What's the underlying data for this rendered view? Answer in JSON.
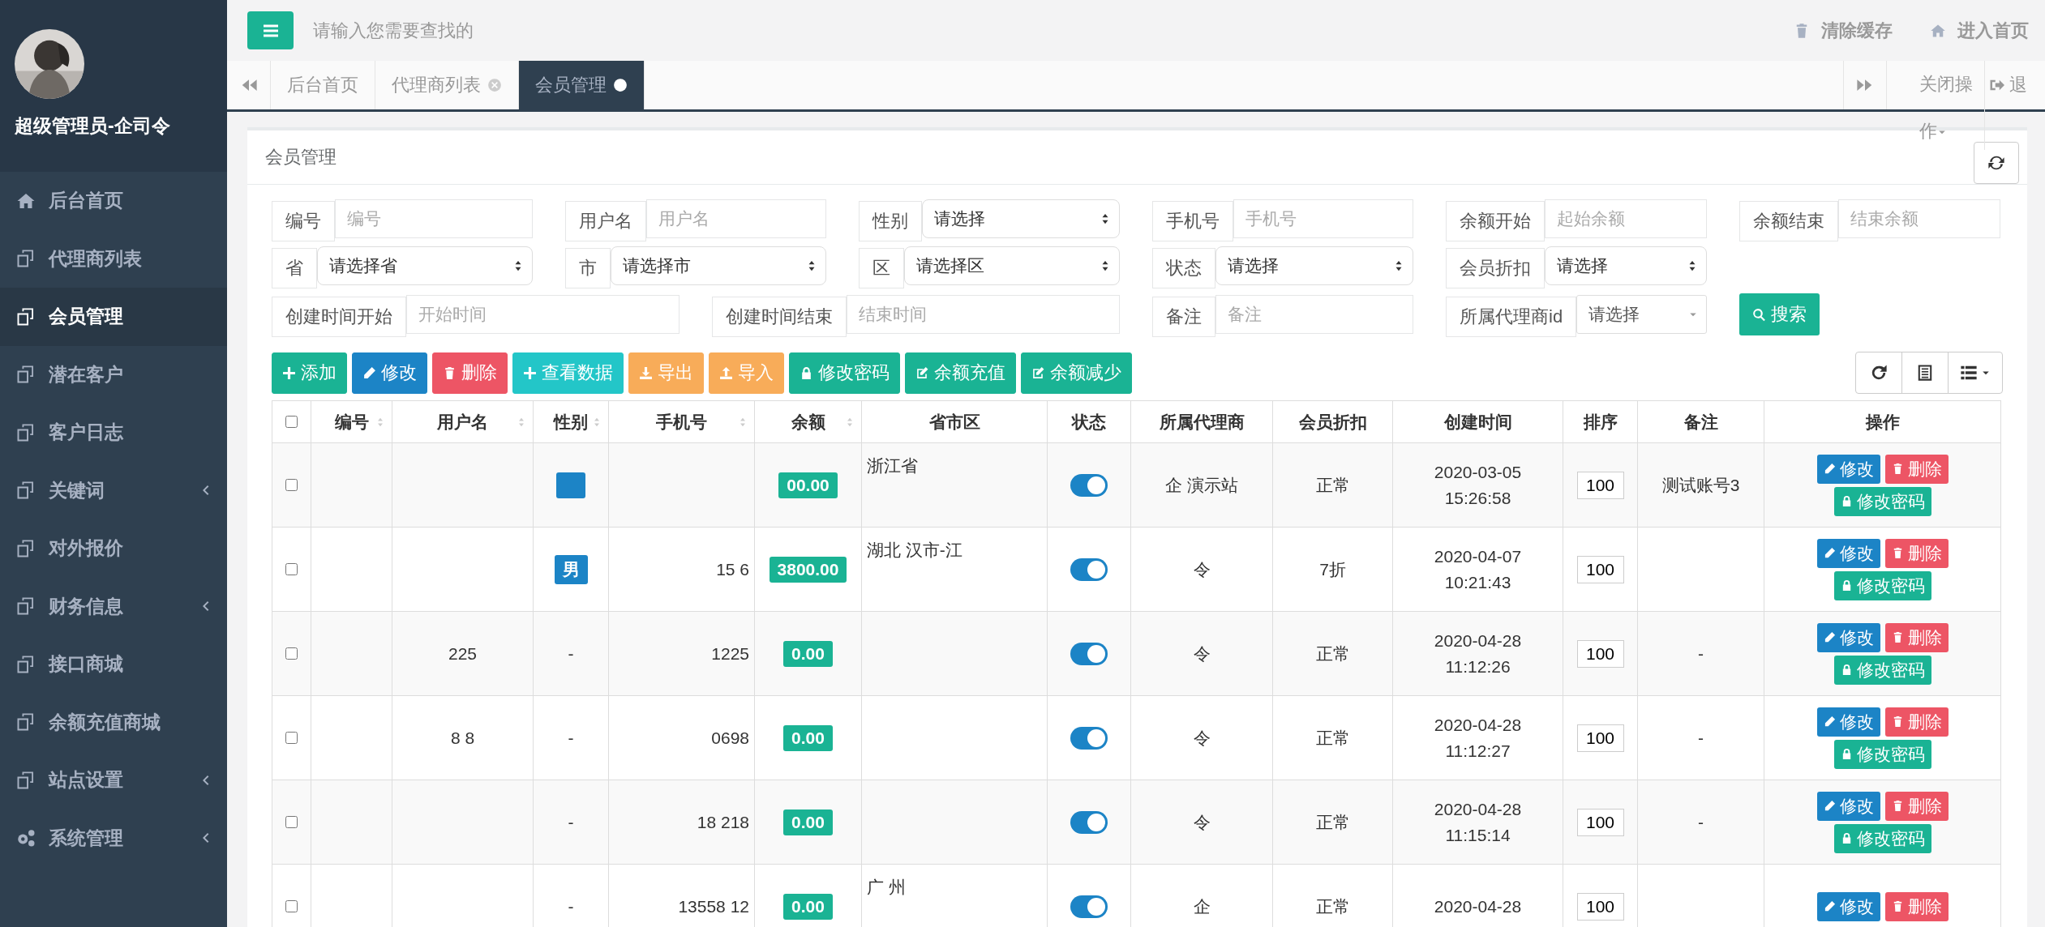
{
  "sidebar": {
    "user_name": "超级管理员-企司令",
    "items": [
      {
        "label": "后台首页",
        "selected": false,
        "expandable": false
      },
      {
        "label": "代理商列表",
        "selected": false,
        "expandable": false
      },
      {
        "label": "会员管理",
        "selected": true,
        "expandable": false
      },
      {
        "label": "潜在客户",
        "selected": false,
        "expandable": false
      },
      {
        "label": "客户日志",
        "selected": false,
        "expandable": false
      },
      {
        "label": "关键词",
        "selected": false,
        "expandable": true
      },
      {
        "label": "对外报价",
        "selected": false,
        "expandable": false
      },
      {
        "label": "财务信息",
        "selected": false,
        "expandable": true
      },
      {
        "label": "接口商城",
        "selected": false,
        "expandable": false
      },
      {
        "label": "余额充值商城",
        "selected": false,
        "expandable": false
      },
      {
        "label": "站点设置",
        "selected": false,
        "expandable": true
      },
      {
        "label": "系统管理",
        "selected": false,
        "expandable": true
      }
    ]
  },
  "header": {
    "search": {
      "placeholder": "请输入您需要查找的"
    },
    "links": [
      "清除缓存",
      "进入首页"
    ]
  },
  "tabs": {
    "items": [
      {
        "label": "后台首页",
        "selected": false,
        "closable": false
      },
      {
        "label": "代理商列表",
        "selected": false,
        "closable": true
      },
      {
        "label": "会员管理",
        "selected": true,
        "closable": true
      }
    ],
    "close_menu": "关闭操作",
    "logout": "退"
  },
  "panel": {
    "title": "会员管理",
    "filters": [
      [
        {
          "kind": "text",
          "label": "编号",
          "placeholder": "编号"
        },
        {
          "kind": "text",
          "label": "用户名",
          "placeholder": "用户名"
        },
        {
          "kind": "select",
          "label": "性别",
          "value": "请选择"
        },
        {
          "kind": "text",
          "label": "手机号",
          "placeholder": "手机号"
        },
        {
          "kind": "text",
          "label": "余额开始",
          "placeholder": "起始余额"
        },
        {
          "kind": "text",
          "label": "余额结束",
          "placeholder": "结束余额"
        }
      ],
      [
        {
          "kind": "select",
          "label": "省",
          "value": "请选择省"
        },
        {
          "kind": "select",
          "label": "市",
          "value": "请选择市"
        },
        {
          "kind": "select",
          "label": "区",
          "value": "请选择区"
        },
        {
          "kind": "select",
          "label": "状态",
          "value": "请选择"
        },
        {
          "kind": "select",
          "label": "会员折扣",
          "value": "请选择"
        }
      ],
      [
        {
          "kind": "date",
          "label": "创建时间开始",
          "placeholder": "开始时间"
        },
        {
          "kind": "date",
          "label": "创建时间结束",
          "placeholder": "结束时间"
        },
        {
          "kind": "text",
          "label": "备注",
          "placeholder": "备注"
        },
        {
          "kind": "combo",
          "label": "所属代理商id",
          "value": "请选择"
        },
        {
          "kind": "search",
          "label": "搜索"
        }
      ]
    ],
    "toolbar": [
      {
        "label": "添加",
        "kind": "add",
        "color": "#1ab394"
      },
      {
        "label": "修改",
        "kind": "edit",
        "color": "#1c84c6"
      },
      {
        "label": "删除",
        "kind": "delete",
        "color": "#ed5565"
      },
      {
        "label": "查看数据",
        "kind": "add",
        "color": "#23c6c8"
      },
      {
        "label": "导出",
        "kind": "download",
        "color": "#f8ac59"
      },
      {
        "label": "导入",
        "kind": "upload",
        "color": "#f8ac59"
      },
      {
        "label": "修改密码",
        "kind": "lock",
        "color": "#1ab394"
      },
      {
        "label": "余额充值",
        "kind": "note",
        "color": "#1ab394"
      },
      {
        "label": "余额减少",
        "kind": "note",
        "color": "#1ab394"
      }
    ],
    "table": {
      "all_checked": false,
      "columns": [
        {
          "label": "编号",
          "sortable": true
        },
        {
          "label": "用户名",
          "sortable": true
        },
        {
          "label": "性别",
          "sortable": true
        },
        {
          "label": "手机号",
          "sortable": true
        },
        {
          "label": "余额",
          "sortable": true
        },
        {
          "label": "省市区",
          "sortable": false
        },
        {
          "label": "状态",
          "sortable": false
        },
        {
          "label": "所属代理商",
          "sortable": false
        },
        {
          "label": "会员折扣",
          "sortable": false
        },
        {
          "label": "创建时间",
          "sortable": false
        },
        {
          "label": "排序",
          "sortable": false
        },
        {
          "label": "备注",
          "sortable": false
        },
        {
          "label": "操作",
          "sortable": false
        }
      ],
      "rows": [
        {
          "checked": false,
          "gender": {
            "kind": "badge"
          },
          "balance": "00.00",
          "region": "浙江省",
          "on": true,
          "agent": "企 演示站",
          "discount": "正常",
          "created": "2020-03-05 15:26:58",
          "sort": "100",
          "remark": "测试账号3",
          "actions": [
            {
              "label": "修改",
              "kind": "edit"
            },
            {
              "label": "删除",
              "kind": "delete"
            },
            {
              "label": "修改密码",
              "kind": "lock"
            }
          ]
        },
        {
          "checked": false,
          "gender": {
            "kind": "badge",
            "label": "男"
          },
          "phone": "15 6",
          "balance": "3800.00",
          "region": "湖北 汉市-江",
          "on": true,
          "agent": "令",
          "discount": "7折",
          "created": "2020-04-07 10:21:43",
          "sort": "100",
          "actions": [
            {
              "label": "修改",
              "kind": "edit"
            },
            {
              "label": "删除",
              "kind": "delete"
            },
            {
              "label": "修改密码",
              "kind": "lock"
            }
          ]
        },
        {
          "checked": false,
          "username": "225",
          "gender": {
            "kind": "text",
            "label": "-"
          },
          "phone": "1225",
          "balance": "0.00",
          "on": true,
          "agent": "令",
          "discount": "正常",
          "created": "2020-04-28 11:12:26",
          "sort": "100",
          "remark": "-",
          "actions": [
            {
              "label": "修改",
              "kind": "edit"
            },
            {
              "label": "删除",
              "kind": "delete"
            },
            {
              "label": "修改密码",
              "kind": "lock"
            }
          ]
        },
        {
          "checked": false,
          "username": "8 8",
          "gender": {
            "kind": "text",
            "label": "-"
          },
          "phone": "0698",
          "balance": "0.00",
          "on": true,
          "agent": "令",
          "discount": "正常",
          "created": "2020-04-28 11:12:27",
          "sort": "100",
          "remark": "-",
          "actions": [
            {
              "label": "修改",
              "kind": "edit"
            },
            {
              "label": "删除",
              "kind": "delete"
            },
            {
              "label": "修改密码",
              "kind": "lock"
            }
          ]
        },
        {
          "checked": false,
          "gender": {
            "kind": "text",
            "label": "-"
          },
          "phone": "18 218",
          "balance": "0.00",
          "on": true,
          "agent": "令",
          "discount": "正常",
          "created": "2020-04-28 11:15:14",
          "sort": "100",
          "remark": "-",
          "actions": [
            {
              "label": "修改",
              "kind": "edit"
            },
            {
              "label": "删除",
              "kind": "delete"
            },
            {
              "label": "修改密码",
              "kind": "lock"
            }
          ]
        },
        {
          "checked": false,
          "gender": {
            "kind": "text",
            "label": "-"
          },
          "phone": "13558 12",
          "balance": "0.00",
          "region": "广 州",
          "on": true,
          "agent": "企",
          "discount": "正常",
          "created": "2020-04-28",
          "sort": "100",
          "actions": [
            {
              "label": "修改",
              "kind": "edit"
            },
            {
              "label": "删除",
              "kind": "delete"
            }
          ]
        }
      ]
    }
  }
}
